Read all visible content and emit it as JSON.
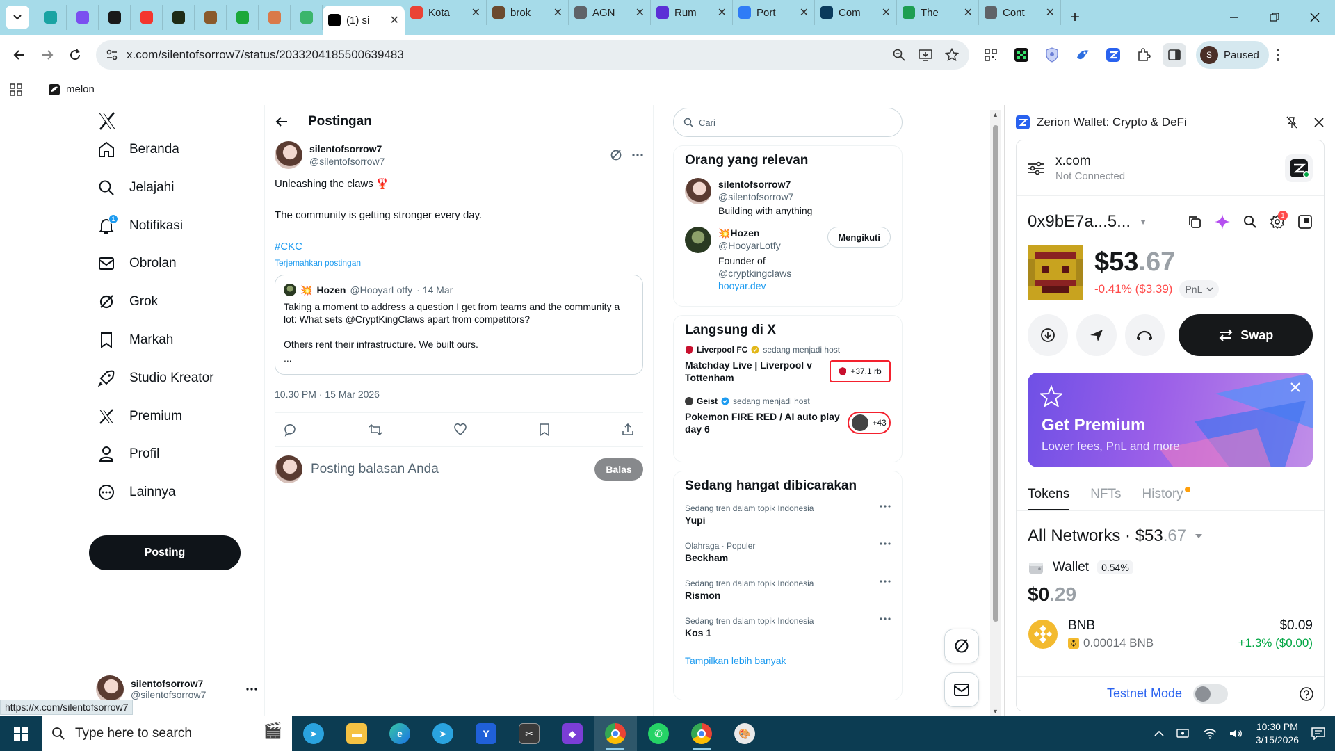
{
  "browser": {
    "tabs": [
      {
        "favicon": "teal-z-icon",
        "color": "#1aa3a3",
        "title": ""
      },
      {
        "favicon": "purple-square-icon",
        "color": "#7b4ff0",
        "title": ""
      },
      {
        "favicon": "black-cube-icon",
        "color": "#1a1a1a",
        "title": ""
      },
      {
        "favicon": "red-star-icon",
        "color": "#f4362e",
        "title": ""
      },
      {
        "favicon": "green-diamond-icon",
        "color": "#1e2b16",
        "title": ""
      },
      {
        "favicon": "brown-character-icon",
        "color": "#8a5a2b",
        "title": ""
      },
      {
        "favicon": "green-frog-icon",
        "color": "#1ba83a",
        "title": ""
      },
      {
        "favicon": "anime-face-icon",
        "color": "#d97a4a",
        "title": ""
      },
      {
        "favicon": "green-wave-icon",
        "color": "#3bb56c",
        "title": ""
      }
    ],
    "wide_tabs": [
      {
        "favicon": "x-icon",
        "color": "#000000",
        "title": "(1) si",
        "active": true
      },
      {
        "favicon": "gmail-icon",
        "color": "#ea4335",
        "title": "Kota"
      },
      {
        "favicon": "brok-icon",
        "color": "#6b4a2e",
        "title": "brok"
      },
      {
        "favicon": "globe-icon",
        "color": "#5f6368",
        "title": "AGN"
      },
      {
        "favicon": "rumble-r-icon",
        "color": "#5b2fd6",
        "title": "Rum"
      },
      {
        "favicon": "portfolio-icon",
        "color": "#2f7cf6",
        "title": "Port"
      },
      {
        "favicon": "com-icon",
        "color": "#0a3b5c",
        "title": "Com"
      },
      {
        "favicon": "the-icon",
        "color": "#1e9e52",
        "title": "The"
      },
      {
        "favicon": "cont-icon",
        "color": "#5f6368",
        "title": "Cont"
      }
    ],
    "url": "x.com/silentofsorrow7/status/2033204185500639483",
    "bookmark": "melon",
    "profile_initial": "S",
    "profile_status": "Paused",
    "status_url": "https://x.com/silentofsorrow7"
  },
  "nav": {
    "items": [
      {
        "label": "Beranda",
        "icon": "home-icon"
      },
      {
        "label": "Jelajahi",
        "icon": "search-icon"
      },
      {
        "label": "Notifikasi",
        "icon": "bell-icon",
        "badge": "1"
      },
      {
        "label": "Obrolan",
        "icon": "mail-icon"
      },
      {
        "label": "Grok",
        "icon": "grok-icon"
      },
      {
        "label": "Markah",
        "icon": "bookmark-icon"
      },
      {
        "label": "Studio Kreator",
        "icon": "rocket-icon"
      },
      {
        "label": "Premium",
        "icon": "x-icon"
      },
      {
        "label": "Profil",
        "icon": "person-icon"
      },
      {
        "label": "Lainnya",
        "icon": "more-circle-icon"
      }
    ],
    "post_label": "Posting",
    "account": {
      "name": "silentofsorrow7",
      "handle": "@silentofsorrow7"
    }
  },
  "main": {
    "header": "Postingan",
    "tweet": {
      "name": "silentofsorrow7",
      "handle": "@silentofsorrow7",
      "line1": "Unleashing the claws 🦞",
      "line2": "The community is getting stronger every day.",
      "hashtag": "#CKC",
      "translate": "Terjemahkan postingan",
      "time": "10.30 PM · 15 Mar 2026"
    },
    "quote": {
      "emoji": "💥",
      "name": "Hozen",
      "handle": "@HooyarLotfy",
      "date": "· 14 Mar",
      "text1": "Taking a moment to address a question I get from teams and the community a lot: What sets @CryptKingClaws  apart from competitors?",
      "text2": "Others rent their infrastructure. We built ours.",
      "text3": "..."
    },
    "reply_placeholder": "Posting balasan Anda",
    "reply_button": "Balas"
  },
  "right": {
    "search_placeholder": "Cari",
    "relevant": {
      "title": "Orang yang relevan",
      "people": [
        {
          "name": "silentofsorrow7",
          "handle": "@silentofsorrow7",
          "bio": "Building with anything"
        },
        {
          "name": "💥Hozen",
          "handle": "@HooyarLotfy",
          "bio_prefix": "Founder of ",
          "bio_link": "@cryptkingclaws",
          "bio_link2": "hooyar.dev",
          "follow": "Mengikuti"
        }
      ]
    },
    "live": {
      "title": "Langsung di X",
      "items": [
        {
          "host": "Liverpool FC",
          "host_suffix": "sedang menjadi host",
          "title": "Matchday Live | Liverpool v Tottenham",
          "count": "+37,1 rb"
        },
        {
          "host": "Geist",
          "host_suffix": "sedang menjadi host",
          "title": "Pokemon FIRE RED / AI auto play day 6",
          "count": "+43"
        }
      ]
    },
    "trends": {
      "title": "Sedang hangat dibicarakan",
      "items": [
        {
          "context": "Sedang tren dalam topik Indonesia",
          "name": "Yupi"
        },
        {
          "context": "Olahraga · Populer",
          "name": "Beckham"
        },
        {
          "context": "Sedang tren dalam topik Indonesia",
          "name": "Rismon"
        },
        {
          "context": "Sedang tren dalam topik Indonesia",
          "name": "Kos 1"
        }
      ],
      "show_more": "Tampilkan lebih banyak"
    }
  },
  "wallet": {
    "panel_title": "Zerion Wallet: Crypto & DeFi",
    "site": "x.com",
    "site_status": "Not Connected",
    "address": "0x9bE7a...5...",
    "notif_badge": "1",
    "balance_int": "$53",
    "balance_dec": ".67",
    "change": "-0.41% ($3.39)",
    "pnl_label": "PnL",
    "swap_label": "Swap",
    "premium_title": "Get Premium",
    "premium_subtitle": "Lower fees, PnL and more",
    "tabs": [
      "Tokens",
      "NFTs",
      "History"
    ],
    "networks_label": "All Networks · $53",
    "networks_dec": ".67",
    "wallet_label": "Wallet",
    "wallet_pct": "0.54%",
    "wallet_value_int": "$0",
    "wallet_value_dec": ".29",
    "token": {
      "symbol": "BNB",
      "amount": "0.00014 BNB",
      "value": "$0.09",
      "change": "+1.3% ($0.00)"
    },
    "testnet_label": "Testnet Mode"
  },
  "taskbar": {
    "search_placeholder": "Type here to search",
    "time": "10:30 PM",
    "date": "3/15/2026"
  },
  "colors": {
    "x_blue": "#1d9bf0",
    "zerion_blue": "#2962ef",
    "negative": "#ff4a4a",
    "positive": "#01a643",
    "tab_bar": "#a6dbe9",
    "taskbar": "#0c3c52"
  }
}
